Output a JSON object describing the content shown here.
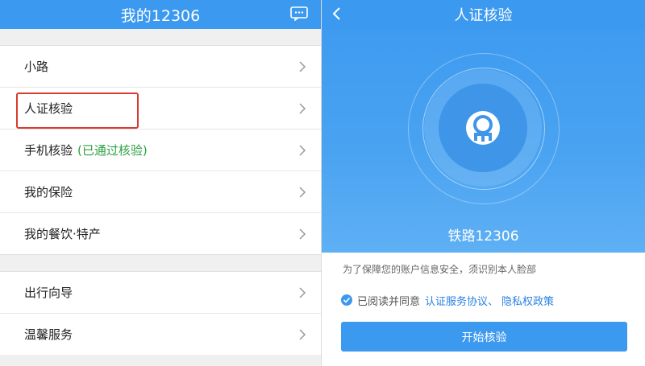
{
  "left": {
    "title": "我的12306",
    "group1": [
      {
        "label": "小路"
      },
      {
        "label": "人证核验"
      },
      {
        "label": "手机核验",
        "sub": "(已通过核验)"
      },
      {
        "label": "我的保险"
      },
      {
        "label": "我的餐饮·特产"
      }
    ],
    "group2": [
      {
        "label": "出行向导"
      },
      {
        "label": "温馨服务"
      }
    ]
  },
  "right": {
    "title": "人证核验",
    "brand": "铁路12306",
    "notice": "为了保障您的账户信息安全，须识别本人脸部",
    "agree_prefix": "已阅读并同意",
    "link1": "认证服务协议、",
    "link2": "隐私权政策",
    "start_button": "开始核验"
  },
  "colors": {
    "primary": "#3b99ef",
    "highlight": "#d93b2f",
    "link": "#2a82e4",
    "verified": "#2ea043"
  }
}
